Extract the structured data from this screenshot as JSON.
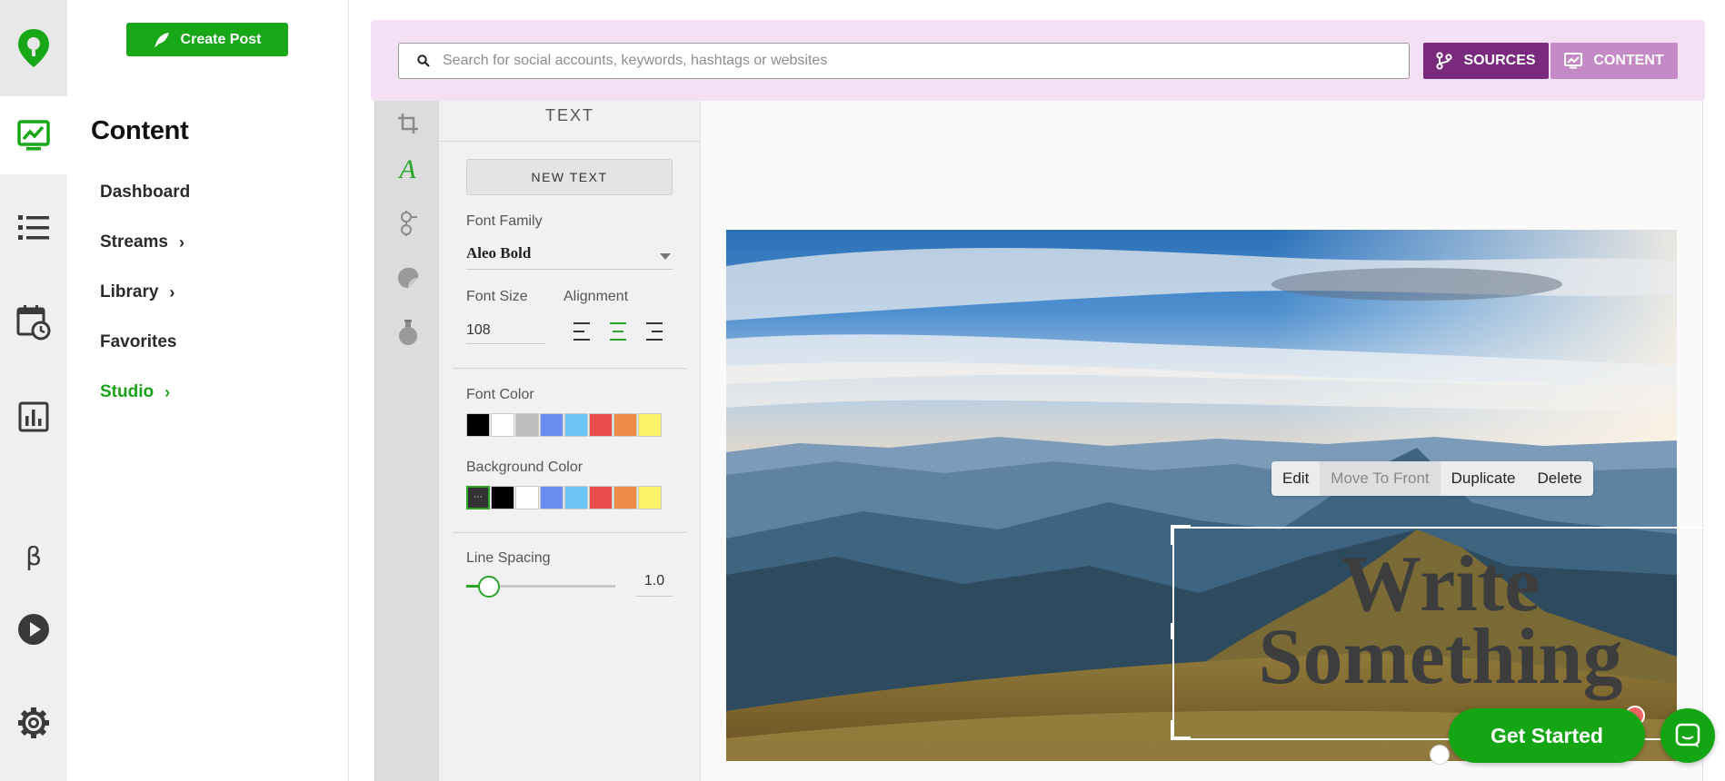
{
  "colors": {
    "brand_green": "#17a717",
    "sources_purple": "#7a2a7c",
    "content_purple": "#c38ac5",
    "topbar_bg": "#f3e0f4"
  },
  "rail": {
    "items": [
      {
        "icon": "location-pin-logo-icon"
      },
      {
        "icon": "content-image-icon",
        "active": true
      },
      {
        "icon": "list-icon"
      },
      {
        "icon": "calendar-clock-icon"
      },
      {
        "icon": "bar-chart-icon"
      },
      {
        "icon": "beta-icon",
        "glyph": "β"
      },
      {
        "icon": "play-icon"
      },
      {
        "icon": "gear-icon"
      }
    ]
  },
  "nav": {
    "create_post_label": "Create Post",
    "title": "Content",
    "links": [
      {
        "label": "Dashboard",
        "has_chevron": false
      },
      {
        "label": "Streams",
        "has_chevron": true
      },
      {
        "label": "Library",
        "has_chevron": true
      },
      {
        "label": "Favorites",
        "has_chevron": false
      },
      {
        "label": "Studio",
        "has_chevron": true,
        "active": true
      }
    ]
  },
  "search": {
    "placeholder": "Search for social accounts, keywords, hashtags or websites",
    "value": ""
  },
  "header_buttons": {
    "sources_label": "SOURCES",
    "content_label": "CONTENT"
  },
  "tools": [
    {
      "icon": "crop-icon"
    },
    {
      "icon": "text-icon",
      "glyph": "A",
      "active": true
    },
    {
      "icon": "filter-adjust-icon"
    },
    {
      "icon": "sticker-icon"
    },
    {
      "icon": "flask-icon"
    }
  ],
  "text_panel": {
    "title": "TEXT",
    "new_text_label": "NEW TEXT",
    "font_family_label": "Font Family",
    "font_family_value": "Aleo Bold",
    "font_size_label": "Font Size",
    "font_size_value": "108",
    "alignment_label": "Alignment",
    "alignment_selected": "center",
    "font_color_label": "Font Color",
    "font_colors": [
      "#000000",
      "#ffffff",
      "#bdbdbd",
      "#6a8df2",
      "#6cc3f5",
      "#e84c4c",
      "#f08a4b",
      "#fbf26a"
    ],
    "background_color_label": "Background Color",
    "background_colors": [
      "none",
      "#000000",
      "#ffffff",
      "#6a8df2",
      "#6cc3f5",
      "#e84c4c",
      "#f08a4b",
      "#fbf26a"
    ],
    "background_none_glyph": "⋯",
    "line_spacing_label": "Line Spacing",
    "line_spacing_value": "1.0",
    "line_spacing_fraction": 0.15
  },
  "canvas": {
    "context_menu": [
      "Edit",
      "Move To Front",
      "Duplicate",
      "Delete"
    ],
    "text_line1": "Write",
    "text_line2": "Something"
  },
  "widgets": {
    "get_started_label": "Get Started"
  }
}
